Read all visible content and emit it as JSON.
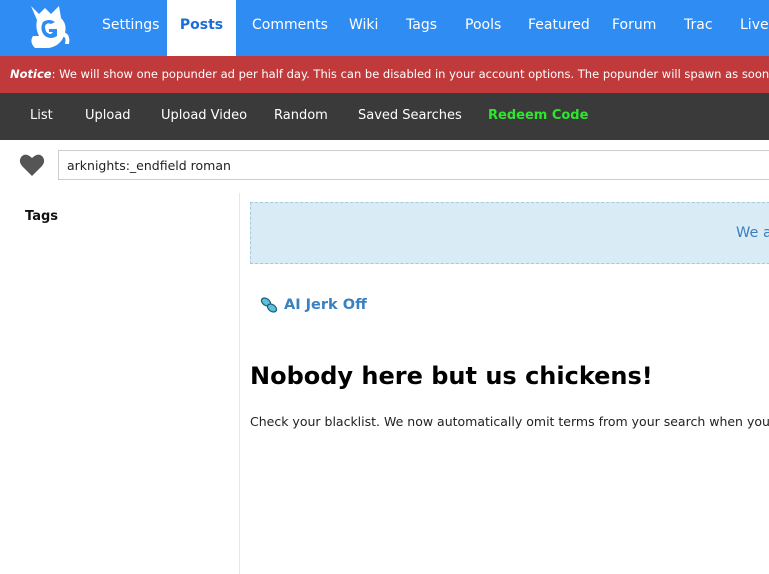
{
  "topnav": {
    "items": [
      {
        "label": "Settings",
        "active": false
      },
      {
        "label": "Posts",
        "active": true
      },
      {
        "label": "Comments",
        "active": false
      },
      {
        "label": "Wiki",
        "active": false
      },
      {
        "label": "Tags",
        "active": false
      },
      {
        "label": "Pools",
        "active": false
      },
      {
        "label": "Featured",
        "active": false
      },
      {
        "label": "Forum",
        "active": false
      },
      {
        "label": "Trac",
        "active": false
      },
      {
        "label": "Live",
        "active": false
      }
    ]
  },
  "notice": {
    "label": "Notice",
    "text": ": We will show one popunder ad per half day. This can be disabled in your account options. The popunder will spawn as soon as yo"
  },
  "subnav": {
    "items": [
      {
        "label": "List"
      },
      {
        "label": "Upload"
      },
      {
        "label": "Upload Video"
      },
      {
        "label": "Random"
      },
      {
        "label": "Saved Searches"
      },
      {
        "label": "Redeem Code"
      }
    ]
  },
  "search": {
    "value": "arknights:_endfield roman"
  },
  "sidebar": {
    "tags_title": "Tags"
  },
  "main": {
    "announcement": "We a",
    "ai_link": "AI Jerk Off",
    "headline": "Nobody here but us chickens!",
    "message": "Check your blacklist. We now automatically omit terms from your search when you ha"
  },
  "colors": {
    "topnav_bg": "#2f8cf3",
    "notice_bg": "#c0393b",
    "subnav_bg": "#3a3a3a",
    "redeem_green": "#2ee62e",
    "link_blue": "#3a7fbf",
    "announce_bg": "#d9ecf5"
  },
  "icons": {
    "logo": "cat-g-logo",
    "favorite": "heart-icon",
    "ai_link": "pill-icon"
  }
}
